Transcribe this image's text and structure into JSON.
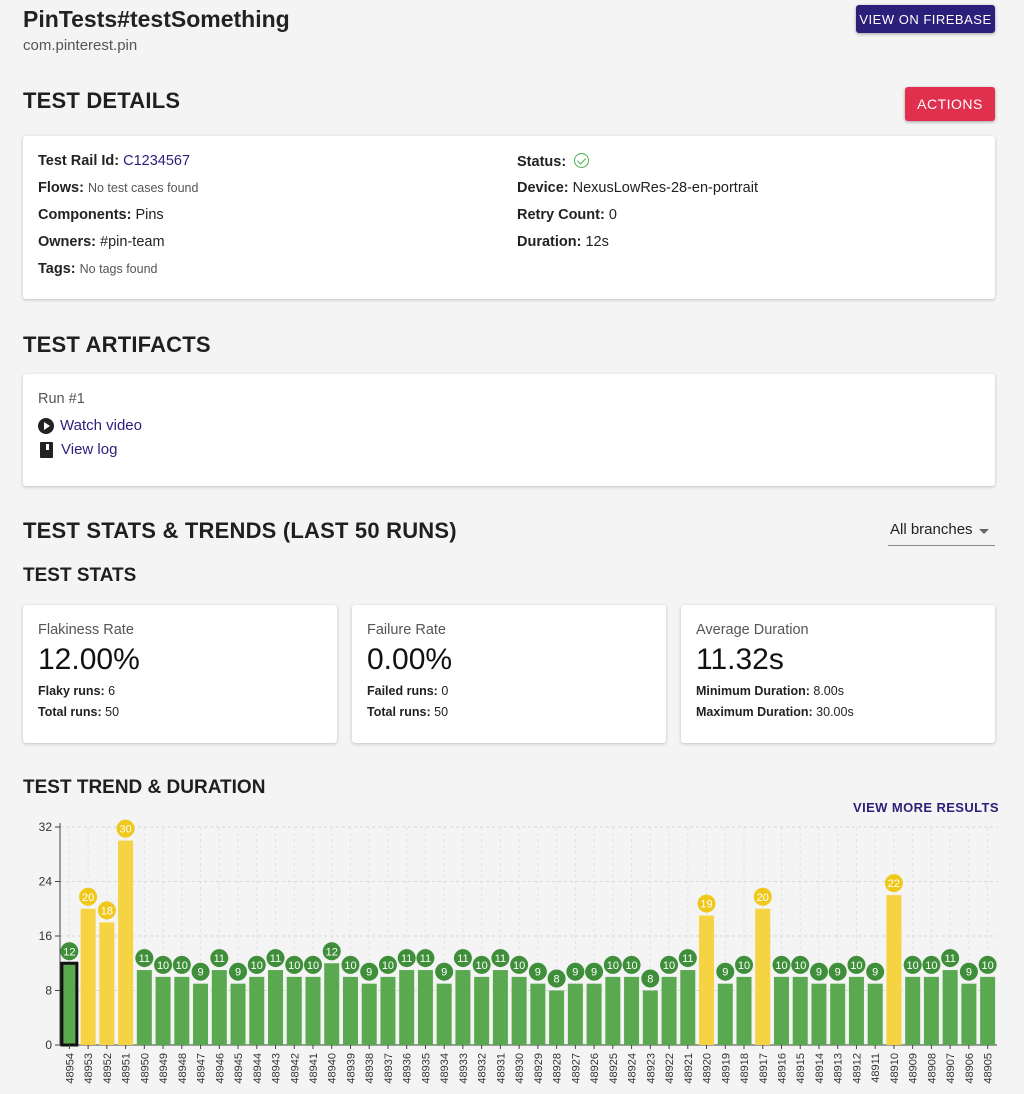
{
  "header": {
    "title": "PinTests#testSomething",
    "package": "com.pinterest.pin",
    "firebase_button": "VIEW ON FIREBASE"
  },
  "details": {
    "heading": "TEST DETAILS",
    "actions_button": "ACTIONS",
    "test_rail_label": "Test Rail Id:",
    "test_rail_value": "C1234567",
    "flows_label": "Flows:",
    "flows_value": "No test cases found",
    "components_label": "Components:",
    "components_value": "Pins",
    "owners_label": "Owners:",
    "owners_value": "#pin-team",
    "tags_label": "Tags:",
    "tags_value": "No tags found",
    "status_label": "Status:",
    "status_icon": "check-circle-icon",
    "device_label": "Device:",
    "device_value": "NexusLowRes-28-en-portrait",
    "retry_label": "Retry Count:",
    "retry_value": "0",
    "duration_label": "Duration:",
    "duration_value": "12s"
  },
  "artifacts": {
    "heading": "TEST ARTIFACTS",
    "run_label": "Run #1",
    "video_link": "Watch video",
    "log_link": "View log"
  },
  "stats_trends": {
    "heading": "TEST STATS & TRENDS (LAST 50 RUNS)",
    "branch_select": "All branches",
    "stats_heading": "TEST STATS",
    "cards": [
      {
        "label": "Flakiness Rate",
        "value": "12.00%",
        "line1_label": "Flaky runs:",
        "line1_value": "6",
        "line2_label": "Total runs:",
        "line2_value": "50"
      },
      {
        "label": "Failure Rate",
        "value": "0.00%",
        "line1_label": "Failed runs:",
        "line1_value": "0",
        "line2_label": "Total runs:",
        "line2_value": "50"
      },
      {
        "label": "Average Duration",
        "value": "11.32s",
        "line1_label": "Minimum Duration:",
        "line1_value": "8.00s",
        "line2_label": "Maximum Duration:",
        "line2_value": "30.00s"
      }
    ],
    "trend_heading": "TEST TREND & DURATION",
    "view_more": "VIEW MORE RESULTS"
  },
  "colors": {
    "pass": "#5aa84f",
    "pass_badge": "#3f8f3a",
    "flaky": "#f5d342",
    "flaky_badge": "#f0c81c",
    "primary": "#2b1f7a",
    "accent": "#e0304d"
  },
  "chart_data": {
    "type": "bar",
    "title": "",
    "ylim": [
      0,
      32
    ],
    "yticks": [
      0,
      8,
      16,
      24,
      32
    ],
    "grid": true,
    "selected_run": "48954",
    "categories": [
      "48954",
      "48953",
      "48952",
      "48951",
      "48950",
      "48949",
      "48948",
      "48947",
      "48946",
      "48945",
      "48944",
      "48943",
      "48942",
      "48941",
      "48940",
      "48939",
      "48938",
      "48937",
      "48936",
      "48935",
      "48934",
      "48933",
      "48932",
      "48931",
      "48930",
      "48929",
      "48928",
      "48927",
      "48926",
      "48925",
      "48924",
      "48923",
      "48922",
      "48921",
      "48920",
      "48919",
      "48918",
      "48917",
      "48916",
      "48915",
      "48914",
      "48913",
      "48912",
      "48911",
      "48910",
      "48909",
      "48908",
      "48907",
      "48906",
      "48905"
    ],
    "values": [
      12,
      20,
      18,
      30,
      11,
      10,
      10,
      9,
      11,
      9,
      10,
      11,
      10,
      10,
      12,
      10,
      9,
      10,
      11,
      11,
      9,
      11,
      10,
      11,
      10,
      9,
      8,
      9,
      9,
      10,
      10,
      8,
      10,
      11,
      19,
      9,
      10,
      20,
      10,
      10,
      9,
      9,
      10,
      9,
      22,
      10,
      10,
      11,
      9,
      10
    ],
    "status": [
      "pass",
      "flaky",
      "flaky",
      "flaky",
      "pass",
      "pass",
      "pass",
      "pass",
      "pass",
      "pass",
      "pass",
      "pass",
      "pass",
      "pass",
      "pass",
      "pass",
      "pass",
      "pass",
      "pass",
      "pass",
      "pass",
      "pass",
      "pass",
      "pass",
      "pass",
      "pass",
      "pass",
      "pass",
      "pass",
      "pass",
      "pass",
      "pass",
      "pass",
      "pass",
      "flaky",
      "pass",
      "pass",
      "flaky",
      "pass",
      "pass",
      "pass",
      "pass",
      "pass",
      "pass",
      "flaky",
      "pass",
      "pass",
      "pass",
      "pass",
      "pass"
    ]
  }
}
